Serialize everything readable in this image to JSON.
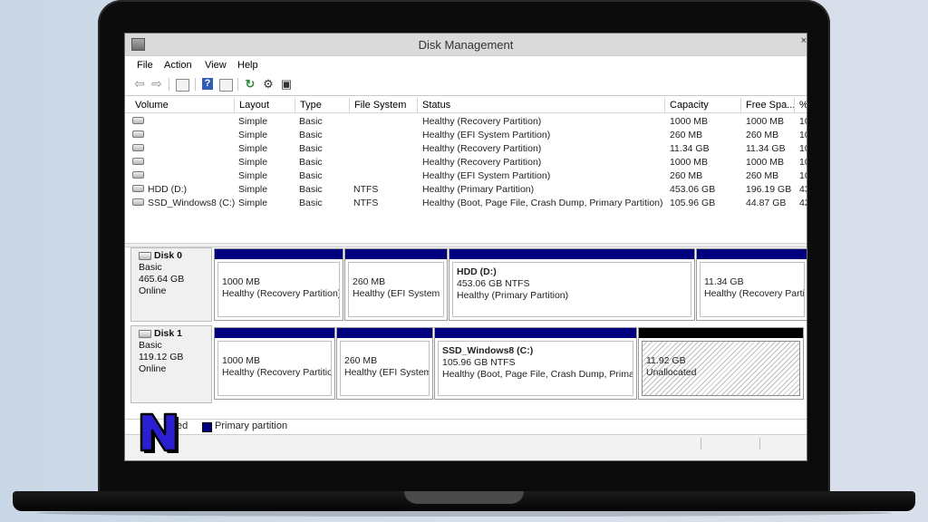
{
  "window": {
    "title": "Disk Management",
    "close_glyph": "×"
  },
  "menu": [
    "File",
    "Action",
    "View",
    "Help"
  ],
  "toolbar_icons": [
    "back-arrow-icon",
    "forward-arrow-icon",
    "properties-icon",
    "help-icon",
    "list-view-icon",
    "refresh-icon",
    "settings-icon",
    "rescan-disk-icon"
  ],
  "volume_list": {
    "columns": [
      "Volume",
      "Layout",
      "Type",
      "File System",
      "Status",
      "Capacity",
      "Free Spa...",
      "%"
    ],
    "rows": [
      {
        "volume": "",
        "layout": "Simple",
        "type": "Basic",
        "fs": "",
        "status": "Healthy (Recovery Partition)",
        "capacity": "1000 MB",
        "free": "1000 MB",
        "pct": "10"
      },
      {
        "volume": "",
        "layout": "Simple",
        "type": "Basic",
        "fs": "",
        "status": "Healthy (EFI System Partition)",
        "capacity": "260 MB",
        "free": "260 MB",
        "pct": "10"
      },
      {
        "volume": "",
        "layout": "Simple",
        "type": "Basic",
        "fs": "",
        "status": "Healthy (Recovery Partition)",
        "capacity": "11.34 GB",
        "free": "11.34 GB",
        "pct": "10"
      },
      {
        "volume": "",
        "layout": "Simple",
        "type": "Basic",
        "fs": "",
        "status": "Healthy (Recovery Partition)",
        "capacity": "1000 MB",
        "free": "1000 MB",
        "pct": "10"
      },
      {
        "volume": "",
        "layout": "Simple",
        "type": "Basic",
        "fs": "",
        "status": "Healthy (EFI System Partition)",
        "capacity": "260 MB",
        "free": "260 MB",
        "pct": "10"
      },
      {
        "volume": "HDD (D:)",
        "layout": "Simple",
        "type": "Basic",
        "fs": "NTFS",
        "status": "Healthy (Primary Partition)",
        "capacity": "453.06 GB",
        "free": "196.19 GB",
        "pct": "43"
      },
      {
        "volume": "SSD_Windows8 (C:)",
        "layout": "Simple",
        "type": "Basic",
        "fs": "NTFS",
        "status": "Healthy (Boot, Page File, Crash Dump, Primary Partition)",
        "capacity": "105.96 GB",
        "free": "44.87 GB",
        "pct": "42"
      }
    ]
  },
  "disks": [
    {
      "name": "Disk 0",
      "type": "Basic",
      "size": "465.64 GB",
      "state": "Online",
      "partitions": [
        {
          "name": "",
          "size": "1000 MB",
          "status": "Healthy (Recovery Partition)"
        },
        {
          "name": "",
          "size": "260 MB",
          "status": "Healthy (EFI System P"
        },
        {
          "name": "HDD  (D:)",
          "size": "453.06 GB NTFS",
          "status": "Healthy (Primary Partition)"
        },
        {
          "name": "",
          "size": "11.34 GB",
          "status": "Healthy (Recovery Partiti"
        }
      ]
    },
    {
      "name": "Disk 1",
      "type": "Basic",
      "size": "119.12 GB",
      "state": "Online",
      "partitions": [
        {
          "name": "",
          "size": "1000 MB",
          "status": "Healthy (Recovery Partitio"
        },
        {
          "name": "",
          "size": "260 MB",
          "status": "Healthy (EFI System"
        },
        {
          "name": "SSD_Windows8  (C:)",
          "size": "105.96 GB NTFS",
          "status": "Healthy (Boot, Page File, Crash Dump, Primar"
        },
        {
          "name": "",
          "size": "11.92 GB",
          "status": "Unallocated"
        }
      ]
    }
  ],
  "legend": {
    "unallocated_partial": "ted",
    "primary": "Primary partition"
  },
  "colors": {
    "primary_partition": "#00007f",
    "unallocated": "#000000",
    "logo_fill": "#2a1fd1"
  },
  "logo": {
    "text": "N"
  }
}
